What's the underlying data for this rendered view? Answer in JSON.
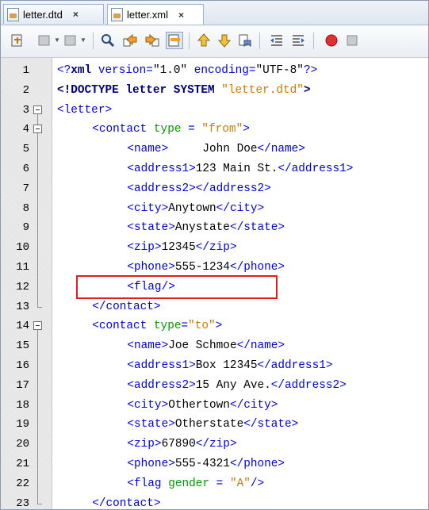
{
  "tabs": [
    {
      "label": "letter.dtd",
      "close": "×"
    },
    {
      "label": "letter.xml",
      "close": "×"
    }
  ],
  "lines": [
    {
      "n": "1",
      "indent": 0,
      "segs": [
        [
          "t",
          "<?"
        ],
        [
          "kw",
          "xml"
        ],
        [
          "t",
          " version="
        ],
        [
          "tx",
          "\"1.0\""
        ],
        [
          "t",
          " encoding="
        ],
        [
          "tx",
          "\"UTF-8\""
        ],
        [
          "t",
          "?>"
        ]
      ]
    },
    {
      "n": "2",
      "indent": 0,
      "segs": [
        [
          "kw",
          "<!DOCTYPE letter SYSTEM "
        ],
        [
          "vl",
          "\"letter.dtd\""
        ],
        [
          "kw",
          ">"
        ]
      ]
    },
    {
      "n": "3",
      "indent": 0,
      "segs": [
        [
          "t",
          "<letter>"
        ]
      ]
    },
    {
      "n": "4",
      "indent": 1,
      "segs": [
        [
          "t",
          "<contact "
        ],
        [
          "at",
          "type"
        ],
        [
          "t",
          " = "
        ],
        [
          "vl",
          "\"from\""
        ],
        [
          "t",
          ">"
        ]
      ]
    },
    {
      "n": "5",
      "indent": 2,
      "segs": [
        [
          "t",
          "<name>"
        ],
        [
          "tx",
          "     John Doe"
        ],
        [
          "t",
          "</name>"
        ]
      ]
    },
    {
      "n": "6",
      "indent": 2,
      "segs": [
        [
          "t",
          "<address1>"
        ],
        [
          "tx",
          "123 Main St."
        ],
        [
          "t",
          "</address1>"
        ]
      ]
    },
    {
      "n": "7",
      "indent": 2,
      "segs": [
        [
          "t",
          "<address2></address2>"
        ]
      ]
    },
    {
      "n": "8",
      "indent": 2,
      "segs": [
        [
          "t",
          "<city>"
        ],
        [
          "tx",
          "Anytown"
        ],
        [
          "t",
          "</city>"
        ]
      ]
    },
    {
      "n": "9",
      "indent": 2,
      "segs": [
        [
          "t",
          "<state>"
        ],
        [
          "tx",
          "Anystate"
        ],
        [
          "t",
          "</state>"
        ]
      ]
    },
    {
      "n": "10",
      "indent": 2,
      "segs": [
        [
          "t",
          "<zip>"
        ],
        [
          "tx",
          "12345"
        ],
        [
          "t",
          "</zip>"
        ]
      ]
    },
    {
      "n": "11",
      "indent": 2,
      "segs": [
        [
          "t",
          "<phone>"
        ],
        [
          "tx",
          "555-1234"
        ],
        [
          "t",
          "</phone>"
        ]
      ]
    },
    {
      "n": "12",
      "indent": 2,
      "segs": [
        [
          "t",
          "<flag/>"
        ]
      ]
    },
    {
      "n": "13",
      "indent": 1,
      "segs": [
        [
          "t",
          "</contact>"
        ]
      ]
    },
    {
      "n": "14",
      "indent": 1,
      "segs": [
        [
          "t",
          "<contact "
        ],
        [
          "at",
          "type"
        ],
        [
          "t",
          "="
        ],
        [
          "vl",
          "\"to\""
        ],
        [
          "t",
          ">"
        ]
      ]
    },
    {
      "n": "15",
      "indent": 2,
      "segs": [
        [
          "t",
          "<name>"
        ],
        [
          "tx",
          "Joe Schmoe"
        ],
        [
          "t",
          "</name>"
        ]
      ]
    },
    {
      "n": "16",
      "indent": 2,
      "segs": [
        [
          "t",
          "<address1>"
        ],
        [
          "tx",
          "Box 12345"
        ],
        [
          "t",
          "</address1>"
        ]
      ]
    },
    {
      "n": "17",
      "indent": 2,
      "segs": [
        [
          "t",
          "<address2>"
        ],
        [
          "tx",
          "15 Any Ave."
        ],
        [
          "t",
          "</address2>"
        ]
      ]
    },
    {
      "n": "18",
      "indent": 2,
      "segs": [
        [
          "t",
          "<city>"
        ],
        [
          "tx",
          "Othertown"
        ],
        [
          "t",
          "</city>"
        ]
      ]
    },
    {
      "n": "19",
      "indent": 2,
      "segs": [
        [
          "t",
          "<state>"
        ],
        [
          "tx",
          "Otherstate"
        ],
        [
          "t",
          "</state>"
        ]
      ]
    },
    {
      "n": "20",
      "indent": 2,
      "segs": [
        [
          "t",
          "<zip>"
        ],
        [
          "tx",
          "67890"
        ],
        [
          "t",
          "</zip>"
        ]
      ]
    },
    {
      "n": "21",
      "indent": 2,
      "segs": [
        [
          "t",
          "<phone>"
        ],
        [
          "tx",
          "555-4321"
        ],
        [
          "t",
          "</phone>"
        ]
      ]
    },
    {
      "n": "22",
      "indent": 2,
      "segs": [
        [
          "t",
          "<flag "
        ],
        [
          "at",
          "gender"
        ],
        [
          "t",
          " = "
        ],
        [
          "vl",
          "\"A\""
        ],
        [
          "t",
          "/>"
        ]
      ]
    },
    {
      "n": "23",
      "indent": 1,
      "segs": [
        [
          "t",
          "</contact>"
        ]
      ]
    }
  ],
  "highlight_line": "12",
  "colors": {
    "tag": "#0000e6",
    "attribute": "#009900",
    "value": "#ce7b00",
    "highlight_box": "#e02020"
  }
}
